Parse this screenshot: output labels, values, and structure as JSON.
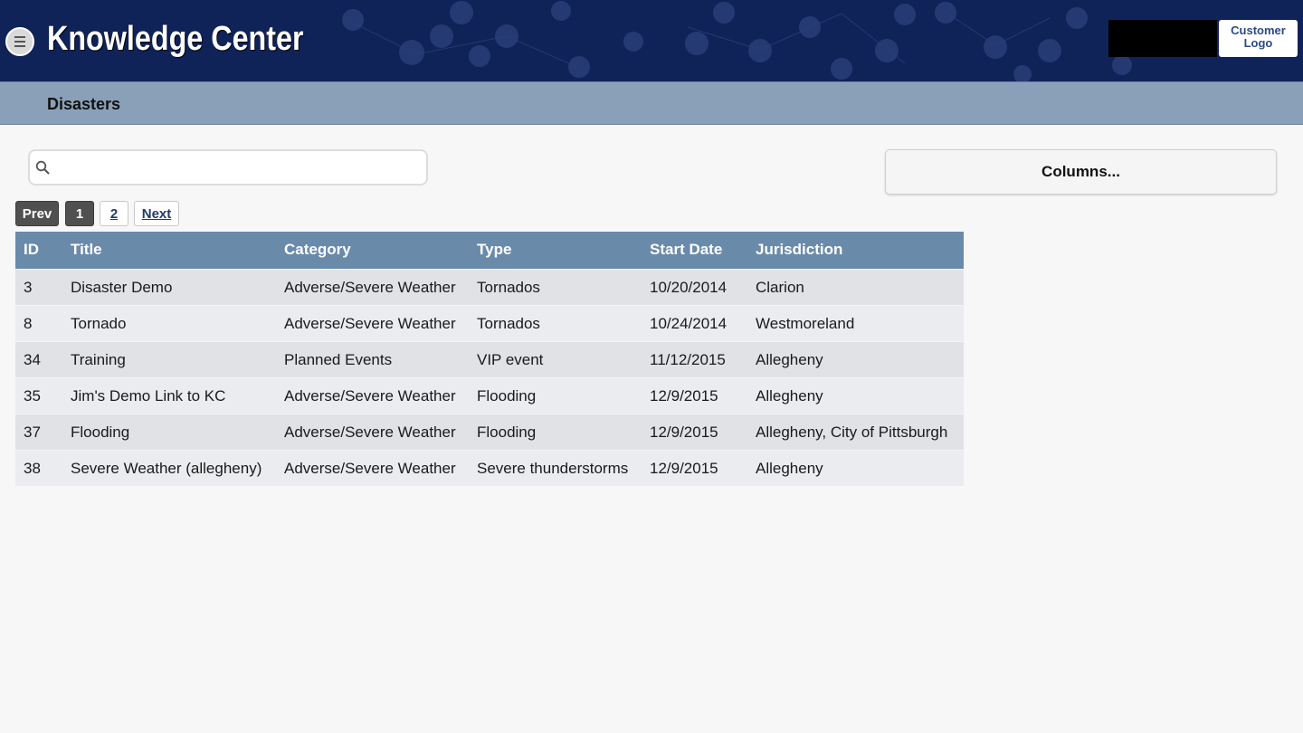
{
  "header": {
    "app_title": "Knowledge Center",
    "customer_logo_line1": "Customer",
    "customer_logo_line2": "Logo",
    "menu_icon": "hamburger-menu-icon",
    "background_color": "#0f2358"
  },
  "subheader": {
    "title": "Disasters"
  },
  "search": {
    "placeholder": "",
    "value": "",
    "icon": "search-icon"
  },
  "columns_button": {
    "label": "Columns..."
  },
  "pagination": {
    "prev_label": "Prev",
    "pages": [
      "1",
      "2"
    ],
    "current_page": "1",
    "next_label": "Next"
  },
  "table": {
    "header_color": "#6a8aaa",
    "columns": [
      "ID",
      "Title",
      "Category",
      "Type",
      "Start Date",
      "Jurisdiction"
    ],
    "rows": [
      {
        "id": "3",
        "title": "Disaster Demo",
        "category": "Adverse/Severe Weather",
        "type": "Tornados",
        "start_date": "10/20/2014",
        "jurisdiction": "Clarion"
      },
      {
        "id": "8",
        "title": "Tornado",
        "category": "Adverse/Severe Weather",
        "type": "Tornados",
        "start_date": "10/24/2014",
        "jurisdiction": "Westmoreland"
      },
      {
        "id": "34",
        "title": "Training",
        "category": "Planned Events",
        "type": "VIP event",
        "start_date": "11/12/2015",
        "jurisdiction": "Allegheny"
      },
      {
        "id": "35",
        "title": "Jim's Demo Link to KC",
        "category": "Adverse/Severe Weather",
        "type": "Flooding",
        "start_date": "12/9/2015",
        "jurisdiction": "Allegheny"
      },
      {
        "id": "37",
        "title": "Flooding",
        "category": "Adverse/Severe Weather",
        "type": "Flooding",
        "start_date": "12/9/2015",
        "jurisdiction": "Allegheny, City of Pittsburgh"
      },
      {
        "id": "38",
        "title": "Severe Weather (allegheny)",
        "category": "Adverse/Severe Weather",
        "type": "Severe thunderstorms",
        "start_date": "12/9/2015",
        "jurisdiction": "Allegheny"
      }
    ]
  }
}
